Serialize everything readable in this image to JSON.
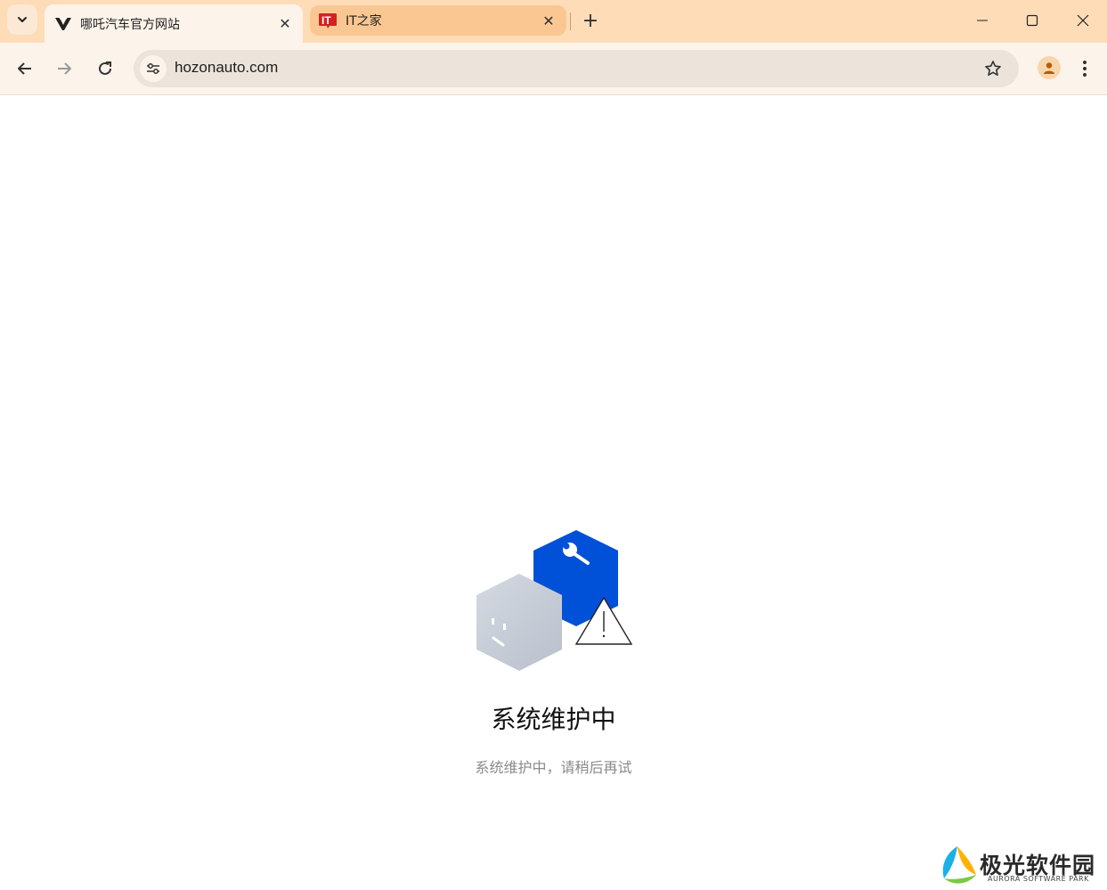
{
  "browser": {
    "tabs": [
      {
        "title": "哪吒汽车官方网站",
        "favicon": "hozon-logo-icon",
        "active": true
      },
      {
        "title": "IT之家",
        "favicon": "ithome-logo-icon",
        "active": false
      }
    ],
    "url": "hozonauto.com"
  },
  "page": {
    "heading": "系统维护中",
    "subtext": "系统维护中，请稍后再试"
  },
  "watermark": {
    "title": "极光软件园",
    "subtitle": "AURORA SOFTWARE PARK"
  },
  "colors": {
    "titlebar": "#fddcb7",
    "toolbar": "#fcf3ea",
    "accent_blue": "#0050d8"
  }
}
